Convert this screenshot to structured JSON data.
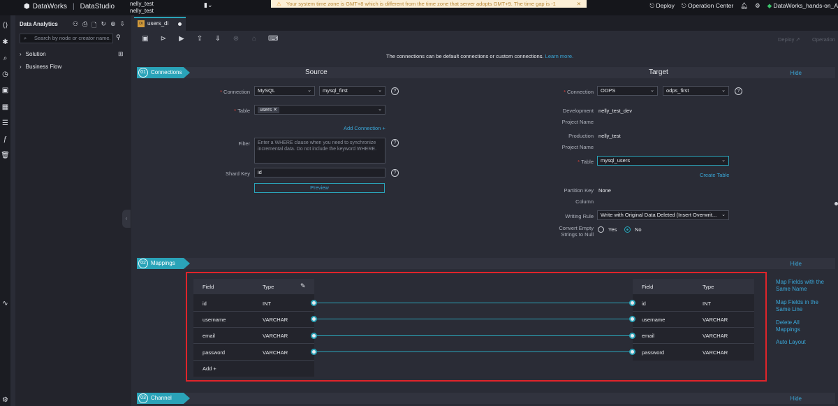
{
  "topbar": {
    "brand": "DataWorks",
    "product": "DataStudio",
    "user_line1": "nelly_test",
    "user_line2": "nelly_test",
    "tz_warning": "Your system time zone is GMT+8 which is different from the time zone that server adopts GMT+9. The time gap is -1",
    "deploy": "Deploy",
    "operation_center": "Operation Center",
    "workspace": "DataWorks_hands-on_A"
  },
  "panel": {
    "title": "Data Analytics",
    "search_placeholder": "Search by node or creator name.",
    "items": [
      "Solution",
      "Business Flow"
    ]
  },
  "tab": {
    "badge": "DI",
    "label": "users_di"
  },
  "toolbar": {
    "deploy": "Deploy ↗",
    "operation": "Operation"
  },
  "notice": {
    "text": "The connections can be default connections or custom connections.",
    "link": "Learn more."
  },
  "sections": [
    {
      "num": "01",
      "label": "Connections",
      "hide": "Hide"
    },
    {
      "num": "02",
      "label": "Mappings",
      "hide": "Hide"
    },
    {
      "num": "03",
      "label": "Channel",
      "hide": "Hide"
    }
  ],
  "source": {
    "title": "Source",
    "connection_label": "Connection",
    "connection_type": "MySQL",
    "connection_name": "mysql_first",
    "table_label": "Table",
    "table_chip": "users",
    "add_connection": "Add Connection +",
    "filter_label": "Filter",
    "filter_placeholder": "Enter a WHERE clause when you need to synchronize incremental data. Do not include the keyword WHERE.",
    "shard_label": "Shard Key",
    "shard_value": "id",
    "preview": "Preview"
  },
  "target": {
    "title": "Target",
    "connection_label": "Connection",
    "connection_type": "ODPS",
    "connection_name": "odps_first",
    "dev_label_1": "Development",
    "dev_label_2": "Project Name",
    "dev_value": "nelly_test_dev",
    "prod_label_1": "Production",
    "prod_label_2": "Project Name",
    "prod_value": "nelly_test",
    "table_label": "Table",
    "table_value": "mysql_users",
    "create_table": "Create Table",
    "partition_label_1": "Partition Key",
    "partition_label_2": "Column",
    "partition_value": "None",
    "rule_label": "Writing Rule",
    "rule_value": "Write with Original Data Deleted (Insert Overwrit...",
    "convert_label_1": "Convert Empty",
    "convert_label_2": "Strings to Null",
    "yes": "Yes",
    "no": "No"
  },
  "mappings": {
    "field_header": "Field",
    "type_header": "Type",
    "source_rows": [
      {
        "field": "id",
        "type": "INT"
      },
      {
        "field": "username",
        "type": "VARCHAR"
      },
      {
        "field": "email",
        "type": "VARCHAR"
      },
      {
        "field": "password",
        "type": "VARCHAR"
      }
    ],
    "target_rows": [
      {
        "field": "id",
        "type": "INT"
      },
      {
        "field": "username",
        "type": "VARCHAR"
      },
      {
        "field": "email",
        "type": "VARCHAR"
      },
      {
        "field": "password",
        "type": "VARCHAR"
      }
    ],
    "add": "Add +",
    "actions": [
      "Map Fields with the Same Name",
      "Map Fields in the Same Line",
      "Delete All Mappings",
      "Auto Layout"
    ]
  },
  "colors": {
    "accent": "#2aa3b8",
    "link": "#3aa7d8",
    "highlight": "#e0242a"
  }
}
